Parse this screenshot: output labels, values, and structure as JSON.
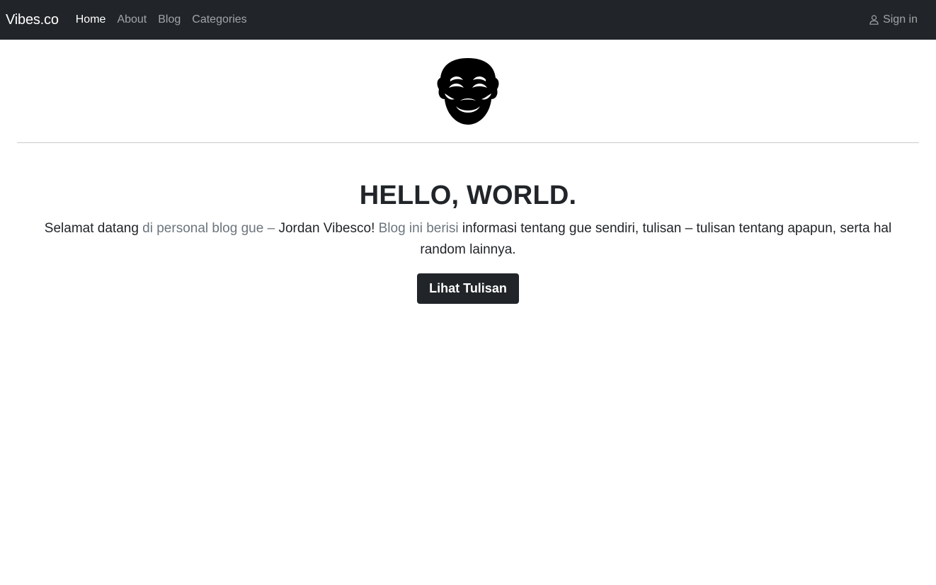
{
  "nav": {
    "brand": "Vibes.co",
    "links": [
      {
        "label": "Home",
        "active": true
      },
      {
        "label": "About",
        "active": false
      },
      {
        "label": "Blog",
        "active": false
      },
      {
        "label": "Categories",
        "active": false
      }
    ],
    "signin_label": "Sign in",
    "signin_icon": "person-icon"
  },
  "logo": {
    "icon": "mask-icon"
  },
  "hero": {
    "title": "HELLO, WORLD.",
    "text_parts": [
      "Selamat datang",
      " di personal blog gue – ",
      "Jordan Vibesco!",
      " Blog ini berisi ",
      "informasi tentang gue sendiri, tulisan – tulisan tentang apapun, serta hal random lainnya."
    ],
    "button_label": "Lihat Tulisan"
  },
  "colors": {
    "navbar_bg": "#212529",
    "text": "#212529",
    "muted": "#6c757d",
    "button_bg": "#212529"
  }
}
